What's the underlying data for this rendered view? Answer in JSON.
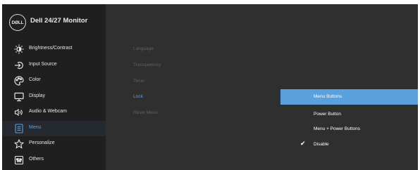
{
  "header": {
    "logo_text": "DØLL",
    "title": "Dell 24/27 Monitor"
  },
  "sidebar": {
    "items": [
      {
        "label": "Brightness/Contrast",
        "icon": "brightness-icon"
      },
      {
        "label": "Input Source",
        "icon": "input-source-icon"
      },
      {
        "label": "Color",
        "icon": "color-icon"
      },
      {
        "label": "Display",
        "icon": "display-icon"
      },
      {
        "label": "Audio & Webcam",
        "icon": "audio-icon"
      },
      {
        "label": "Menu",
        "icon": "menu-icon",
        "active": true
      },
      {
        "label": "Personalize",
        "icon": "star-icon"
      },
      {
        "label": "Others",
        "icon": "others-icon"
      }
    ]
  },
  "submenu": {
    "items": [
      {
        "label": "Language"
      },
      {
        "label": "Transparency"
      },
      {
        "label": "Timer"
      },
      {
        "label": "Lock",
        "active": true
      },
      {
        "label": "Reset Menu"
      }
    ]
  },
  "options": {
    "items": [
      {
        "label": "Menu Buttons",
        "highlighted": true
      },
      {
        "label": "Power Button"
      },
      {
        "label": "Menu + Power Buttons"
      },
      {
        "label": "Disable",
        "checked": true
      }
    ],
    "check_glyph": "✔"
  },
  "colors": {
    "accent": "#5aa0dd",
    "panel_bg": "#2f2f2f",
    "sidebar_bg": "#1f1f1f"
  }
}
